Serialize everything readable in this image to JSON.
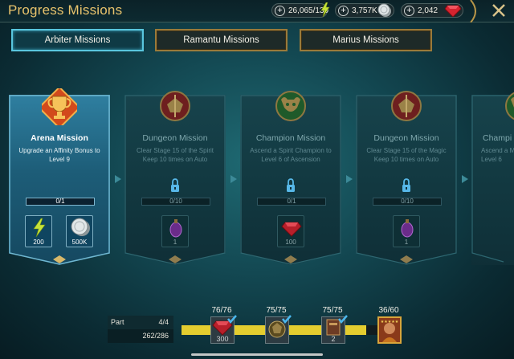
{
  "header": {
    "title": "Progress Missions",
    "currencies": [
      {
        "value": "26,065/130",
        "icon": "energy-bolt-icon"
      },
      {
        "value": "3,757K",
        "icon": "silver-coin-icon"
      },
      {
        "value": "2,042",
        "icon": "ruby-gem-icon"
      }
    ],
    "close_icon": "close-x-icon"
  },
  "tabs": [
    {
      "label": "Arbiter Missions",
      "active": true
    },
    {
      "label": "Ramantu Missions",
      "active": false
    },
    {
      "label": "Marius Missions",
      "active": false
    }
  ],
  "missions": [
    {
      "title": "Arena Mission",
      "description": "Upgrade an Affinity Bonus to Level 9",
      "progress": "0/1",
      "state": "active",
      "emblem": "trophy-icon",
      "rewards": [
        {
          "icon": "energy-bolt-icon",
          "amount": "200"
        },
        {
          "icon": "silver-coin-icon",
          "amount": "500K"
        }
      ]
    },
    {
      "title": "Dungeon Mission",
      "description": "Clear Stage 15 of the Spirit Keep 10 times on Auto",
      "progress": "0/10",
      "state": "locked",
      "emblem": "dungeon-crest-icon",
      "rewards": [
        {
          "icon": "purple-potion-icon",
          "amount": "1"
        }
      ]
    },
    {
      "title": "Champion Mission",
      "description": "Ascend a Spirit Champion to Level 6 of Ascension",
      "progress": "0/1",
      "state": "locked",
      "emblem": "champion-crest-icon",
      "rewards": [
        {
          "icon": "ruby-gem-icon",
          "amount": "100"
        }
      ]
    },
    {
      "title": "Dungeon Mission",
      "description": "Clear Stage 15 of the Magic Keep 10 times on Auto",
      "progress": "0/10",
      "state": "locked",
      "emblem": "dungeon-crest-icon",
      "rewards": [
        {
          "icon": "purple-potion-icon",
          "amount": "1"
        }
      ]
    },
    {
      "title": "Champi",
      "description": "Ascend a M to Level 6",
      "progress": "",
      "state": "locked",
      "emblem": "champion-crest-icon",
      "rewards": []
    }
  ],
  "footer": {
    "part_label": "Part",
    "part_value": "4/4",
    "points": "262/286",
    "stages": [
      {
        "count": "76/76",
        "icon": "ruby-gem-icon",
        "amount": "300",
        "done": true
      },
      {
        "count": "75/75",
        "icon": "champion-crest-icon",
        "amount": "",
        "done": true
      },
      {
        "count": "75/75",
        "icon": "tome-book-icon",
        "amount": "2",
        "done": true
      },
      {
        "count": "36/60",
        "icon": "champion-portrait-icon",
        "amount": "",
        "done": false
      }
    ]
  },
  "colors": {
    "accent_gold": "#e8c36c",
    "active_tab_border": "#59c6de",
    "progress_track": "#e4cd2f"
  }
}
